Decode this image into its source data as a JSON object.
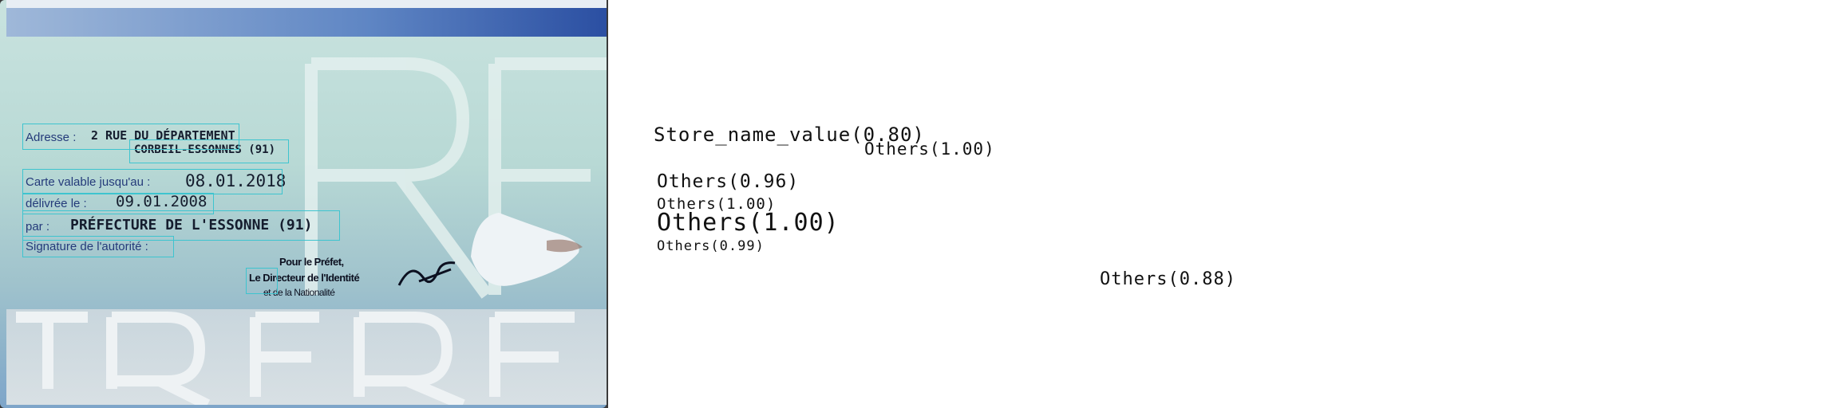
{
  "card": {
    "adresse_label": "Adresse :",
    "adresse_line1": "2 RUE DU DÉPARTEMENT",
    "adresse_line2": "CORBEIL-ESSONNES (91)",
    "validite_label": "Carte valable jusqu'au :",
    "validite_value": "08.01.2018",
    "delivree_label": "délivrée le :",
    "delivree_value": "09.01.2008",
    "par_label": "par :",
    "par_value": "PRÉFECTURE DE L'ESSONNE (91)",
    "signature_label": "Signature de l'autorité :",
    "signature_line1": "Pour le Préfet,",
    "signature_line2": "Le Directeur de l'Identité",
    "signature_line3": "et de la Nationalité"
  },
  "results": [
    {
      "text": "Store_name_value(0.80)"
    },
    {
      "text": "Others(1.00)"
    },
    {
      "text": "Others(0.96)"
    },
    {
      "text": "Others(1.00)"
    },
    {
      "text": "Others(1.00)"
    },
    {
      "text": "Others(0.99)"
    },
    {
      "text": "Others(0.88)"
    }
  ],
  "colors": {
    "box_outline": "#3ec4cf",
    "card_blue": "#2b4fa2",
    "card_teal": "#b8d9d5"
  }
}
